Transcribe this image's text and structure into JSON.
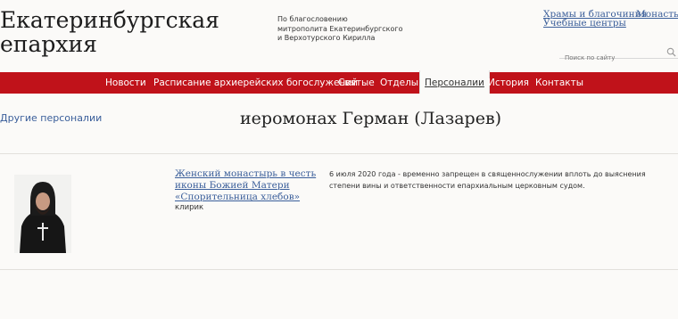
{
  "header": {
    "title_line1": "Екатеринбургская",
    "title_line2": "епархия",
    "blessing_line1": "По благословению",
    "blessing_line2": "митрополита Екатеринбургского",
    "blessing_line3": "и Верхотурского Кирилла",
    "links": [
      "Храмы и благочиния",
      "Монастыри",
      "Учебные центры"
    ],
    "search_placeholder": "Поиск по сайту"
  },
  "nav": {
    "items": [
      "Новости",
      "Расписание архиерейских богослужений",
      "Святые",
      "Отделы",
      "Персоналии",
      "История",
      "Контакты"
    ],
    "active": "Персоналии"
  },
  "main": {
    "other_link": "Другие персоналии",
    "title": "иеромонах Герман (Лазарев)",
    "org_line1": "Женский монастырь в честь",
    "org_line2": "иконы Божией Матери",
    "org_line3": "«Спорительница хлебов»",
    "role": "клирик",
    "note": "6 июля 2020 года - временно запрещен в священнослужении вплоть до выяснения степени вины и ответственности епархиальным церковным судом."
  },
  "colors": {
    "nav_background": "#c0121a",
    "link": "#3a5e9a"
  }
}
